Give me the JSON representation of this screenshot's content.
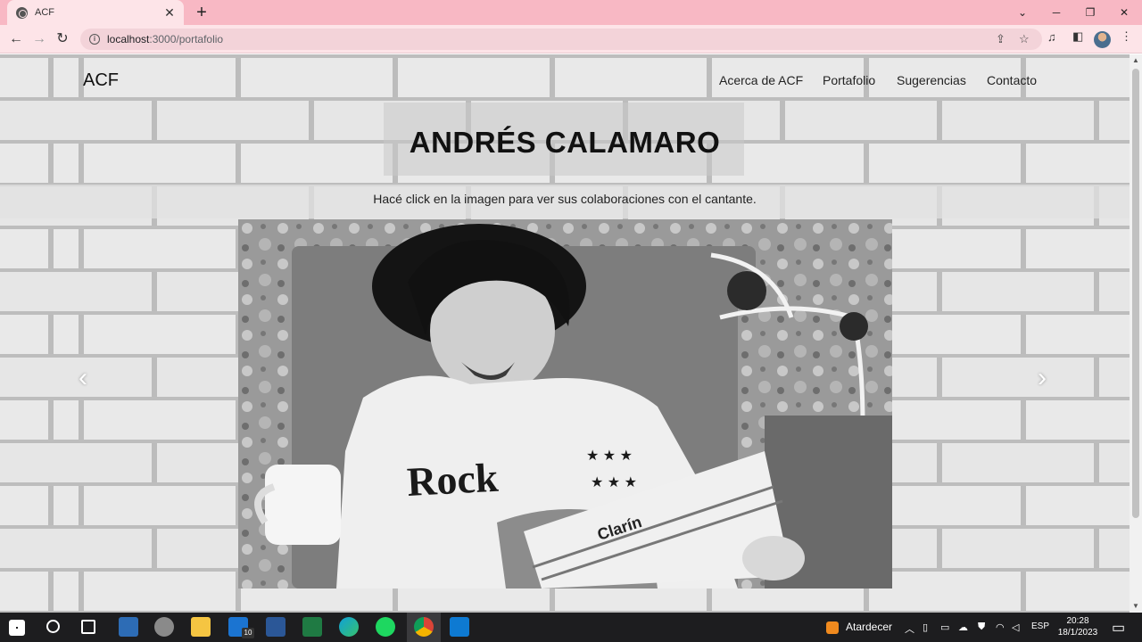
{
  "browser": {
    "tab_title": "ACF",
    "new_tab_label": "+",
    "url_host": "localhost",
    "url_rest": ":3000/portafolio"
  },
  "site": {
    "brand": "ACF",
    "nav": [
      "Acerca de ACF",
      "Portafolio",
      "Sugerencias",
      "Contacto"
    ],
    "title": "ANDRÉS CALAMARO",
    "subtitle": "Hacé click en la imagen para ver sus colaboraciones con el cantante.",
    "carousel": {
      "prev_label": "‹",
      "next_label": "›",
      "shirt_text": "Rock",
      "newspaper_text": "Clarín"
    }
  },
  "taskbar": {
    "mail_badge": "10",
    "weather": "Atardecer",
    "language": "ESP",
    "time": "20:28",
    "date": "18/1/2023"
  },
  "colors": {
    "tab_strip": "#f8b8c4",
    "toolbar": "#fde4e8",
    "taskbar": "#1d1d1f"
  }
}
